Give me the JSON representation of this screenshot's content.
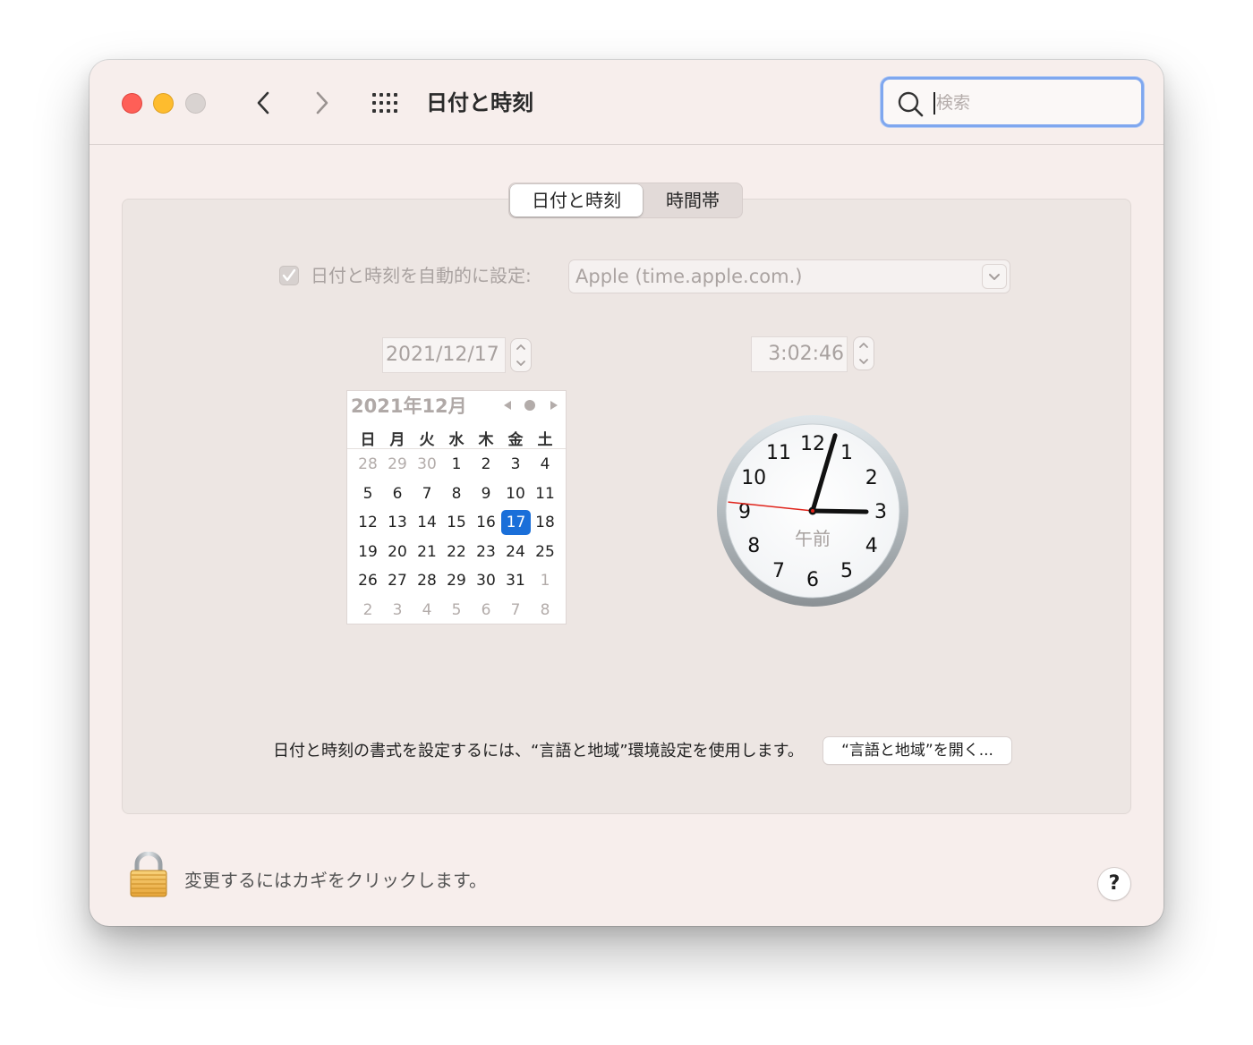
{
  "window": {
    "title": "日付と時刻"
  },
  "search": {
    "placeholder": "検索",
    "value": ""
  },
  "tabs": [
    {
      "label": "日付と時刻",
      "active": true
    },
    {
      "label": "時間帯",
      "active": false
    }
  ],
  "auto_set": {
    "label": "日付と時刻を自動的に設定:",
    "checked": true,
    "server": "Apple (time.apple.com.)"
  },
  "date_field": {
    "value": "2021/12/17"
  },
  "time_field": {
    "value": "3:02:46"
  },
  "calendar": {
    "title": "2021年12月",
    "weekdays": [
      "日",
      "月",
      "火",
      "水",
      "木",
      "金",
      "土"
    ],
    "weeks": [
      [
        {
          "d": "28",
          "m": true
        },
        {
          "d": "29",
          "m": true
        },
        {
          "d": "30",
          "m": true
        },
        {
          "d": "1"
        },
        {
          "d": "2"
        },
        {
          "d": "3"
        },
        {
          "d": "4"
        }
      ],
      [
        {
          "d": "5"
        },
        {
          "d": "6"
        },
        {
          "d": "7"
        },
        {
          "d": "8"
        },
        {
          "d": "9"
        },
        {
          "d": "10"
        },
        {
          "d": "11"
        }
      ],
      [
        {
          "d": "12"
        },
        {
          "d": "13"
        },
        {
          "d": "14"
        },
        {
          "d": "15"
        },
        {
          "d": "16"
        },
        {
          "d": "17",
          "sel": true
        },
        {
          "d": "18"
        }
      ],
      [
        {
          "d": "19"
        },
        {
          "d": "20"
        },
        {
          "d": "21"
        },
        {
          "d": "22"
        },
        {
          "d": "23"
        },
        {
          "d": "24"
        },
        {
          "d": "25"
        }
      ],
      [
        {
          "d": "26"
        },
        {
          "d": "27"
        },
        {
          "d": "28"
        },
        {
          "d": "29"
        },
        {
          "d": "30"
        },
        {
          "d": "31"
        },
        {
          "d": "1",
          "m": true
        }
      ],
      [
        {
          "d": "2",
          "m": true
        },
        {
          "d": "3",
          "m": true
        },
        {
          "d": "4",
          "m": true
        },
        {
          "d": "5",
          "m": true
        },
        {
          "d": "6",
          "m": true
        },
        {
          "d": "7",
          "m": true
        },
        {
          "d": "8",
          "m": true
        }
      ]
    ]
  },
  "clock": {
    "numbers": [
      "12",
      "1",
      "2",
      "3",
      "4",
      "5",
      "6",
      "7",
      "8",
      "9",
      "10",
      "11"
    ],
    "period": "午前",
    "hours": 3,
    "minutes": 2,
    "seconds": 46
  },
  "footer": {
    "text": "日付と時刻の書式を設定するには、“言語と地域”環境設定を使用します。",
    "button_label": "“言語と地域”を開く..."
  },
  "lock": {
    "text": "変更するにはカギをクリックします。"
  },
  "help": {
    "label": "?"
  },
  "colors": {
    "accent": "#1a6fd9",
    "search_focus": "#7fa7ef",
    "window_bg": "#f7eeec",
    "second_hand": "#e0241b"
  }
}
